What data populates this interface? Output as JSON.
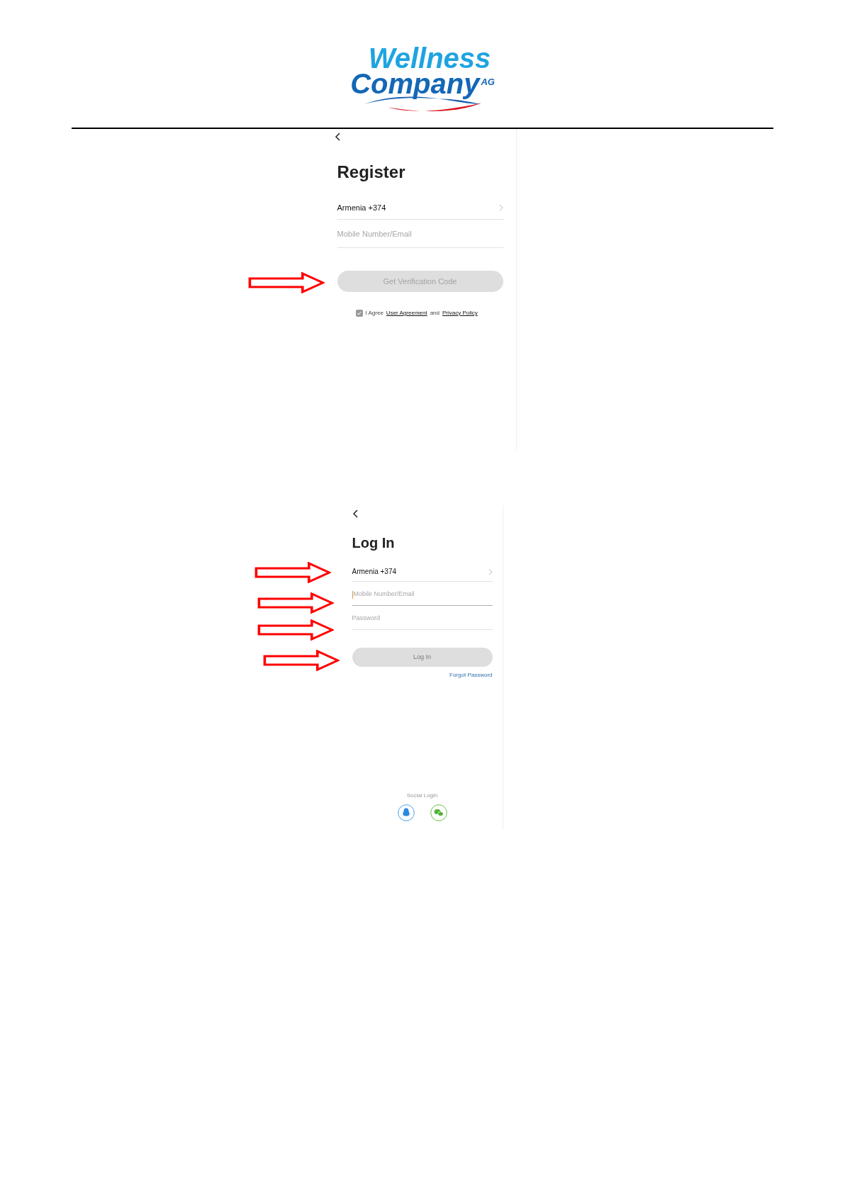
{
  "logo": {
    "line_1": "Wellness",
    "line_2": "Company",
    "suffix": "AG"
  },
  "register_screen": {
    "title": "Register",
    "country": "Armenia +374",
    "field": {
      "placeholder": "Mobile Number/Email",
      "focused": false
    },
    "button": {
      "label": "Get Verification Code",
      "disabled": true
    },
    "agreement": {
      "checked": true,
      "prefix": "I Agree",
      "link_1": "User Agreement",
      "middle": "and",
      "link_2": "Privacy Policy"
    }
  },
  "login_screen": {
    "title": "Log In",
    "country": "Armenia +374",
    "fields": [
      {
        "placeholder": "Mobile Number/Email",
        "focused": true
      },
      {
        "placeholder": "Password",
        "focused": false
      }
    ],
    "button": {
      "label": "Log In",
      "disabled": true
    },
    "forgot_link": "Forgot Password",
    "social_label": "Social Login",
    "social_buttons": [
      {
        "kind": "qq"
      },
      {
        "kind": "wechat"
      }
    ]
  }
}
